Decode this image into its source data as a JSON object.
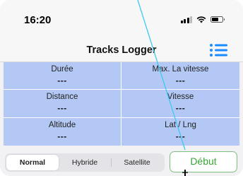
{
  "status_bar": {
    "time": "16:20",
    "icons": [
      "signal-icon",
      "wifi-icon",
      "battery-icon"
    ]
  },
  "nav": {
    "title": "Tracks Logger",
    "menu_icon": "list-icon",
    "accent_color": "#1a8cff"
  },
  "stats": {
    "background_color": "#b3c8f4",
    "cells": [
      {
        "label": "Durée",
        "value": "---"
      },
      {
        "label": "Max. La vitesse",
        "value": "---"
      },
      {
        "label": "Distance",
        "value": "---"
      },
      {
        "label": "Vitesse",
        "value": "---"
      },
      {
        "label": "Altitude",
        "value": "---"
      },
      {
        "label": "Lat / Lng",
        "value": "---"
      }
    ]
  },
  "map_type": {
    "options": [
      "Normal",
      "Hybride",
      "Satellite"
    ],
    "selected": "Normal"
  },
  "start_button": {
    "label": "Début",
    "color": "#36a636"
  }
}
